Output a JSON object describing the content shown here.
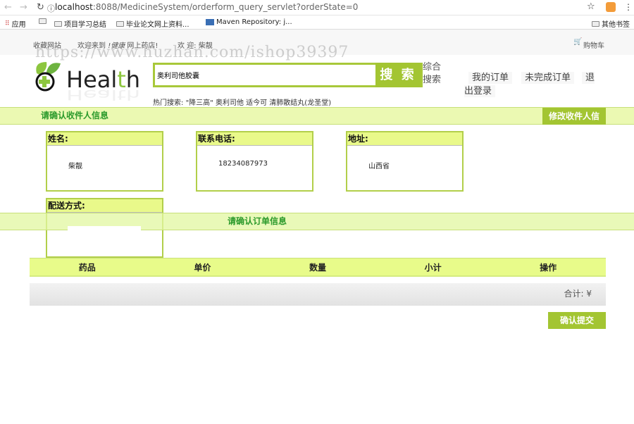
{
  "browser": {
    "url_host": "localhost",
    "url_rest": ":8088/MedicineSystem/orderform_query_servlet?orderState=0",
    "bookmarks": [
      "应用",
      "",
      "项目学习总结",
      "毕业论文网上资料...",
      "Maven Repository: j...",
      "其他书签"
    ]
  },
  "topbar": {
    "favorite": "收藏网站",
    "welcome_prefix": "欢迎来到",
    "welcome_brand": "!健康",
    "welcome_suffix": "网上药店!",
    "greeting": "欢 迎: 柴靓",
    "cart": "购物车"
  },
  "watermark": "https://www.huzhan.com/ishop39397",
  "logo": {
    "text": "Health"
  },
  "search": {
    "value": "奥利司他胶囊",
    "button": "搜 索",
    "advanced": "综合搜索",
    "hot_label": "热门搜索:",
    "hot_terms": "\"降三高\" 奥利司他  适今可  清肺散结丸(龙圣堂)"
  },
  "nav": {
    "my_orders": "我的订单",
    "unfinished": "未完成订单",
    "logout": "退出登录"
  },
  "receiver": {
    "section_title": "请确认收件人信息",
    "edit_button": "修改收件人信",
    "name_label": "姓名:",
    "name": "柴靓",
    "phone_label": "联系电话:",
    "phone": "18234087973",
    "address_label": "地址:",
    "address": "山西省",
    "delivery_label": "配送方式:"
  },
  "order": {
    "section_title": "请确认订单信息",
    "columns": [
      "药品",
      "单价",
      "数量",
      "小计",
      "操作"
    ],
    "total_label": "合计: ¥",
    "submit": "确认提交"
  },
  "colors": {
    "accent": "#a3c532",
    "band": "#ebf9b2",
    "header": "#e8fb8a",
    "title_green": "#2b9a2b"
  }
}
